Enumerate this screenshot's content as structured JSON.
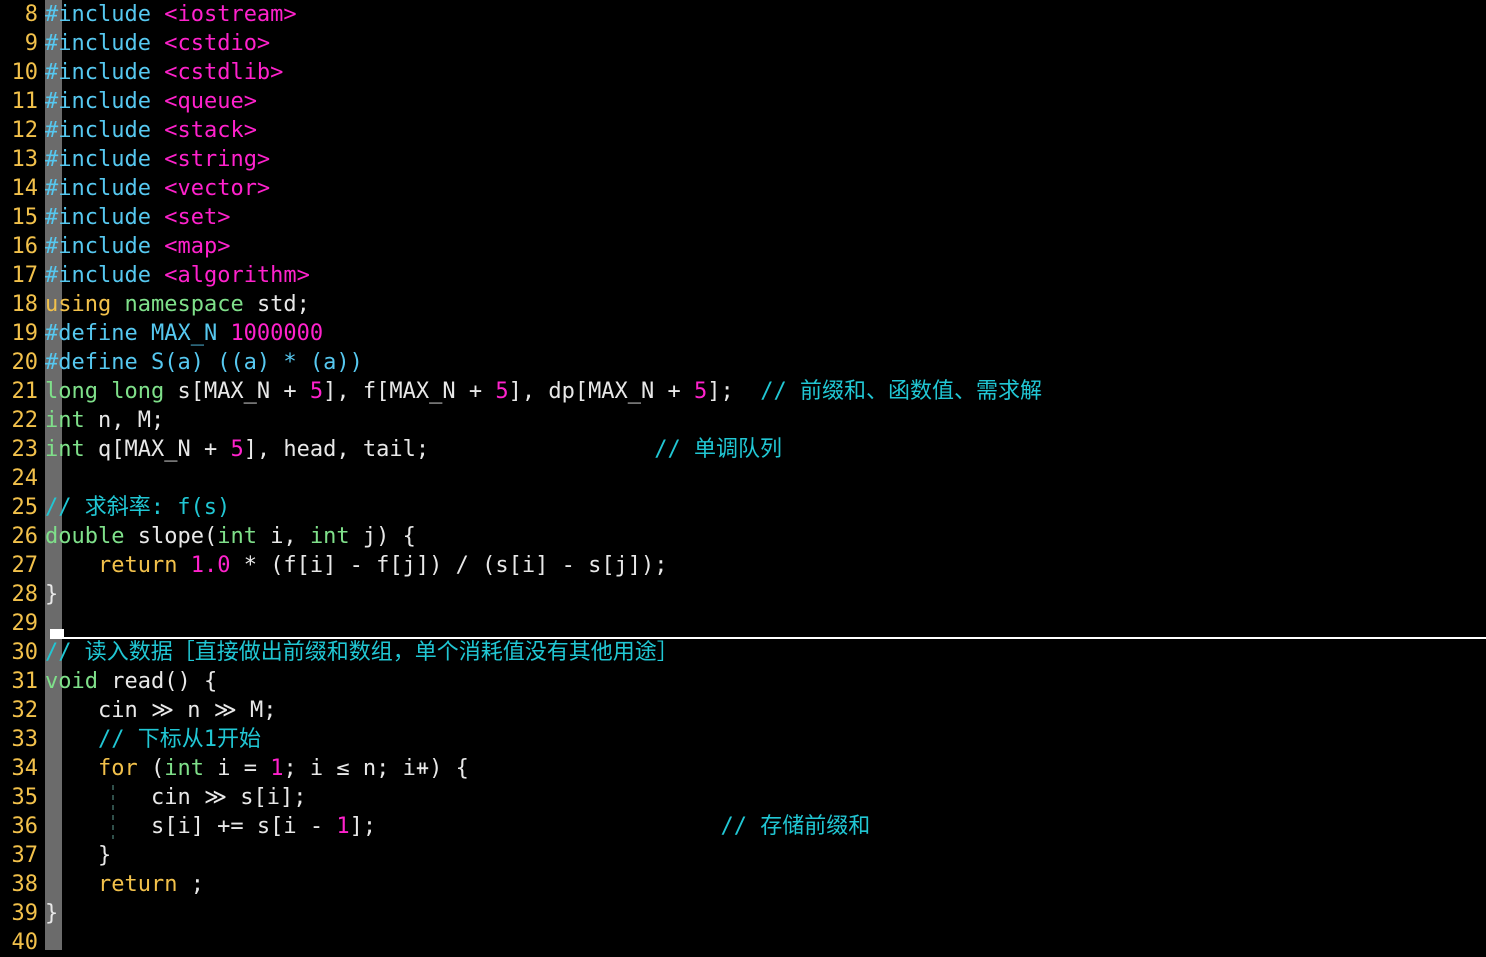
{
  "editor": {
    "language": "C++",
    "first_line": 8,
    "last_line": 40,
    "colors": {
      "background": "#000000",
      "line_number": "#f2c14b",
      "preprocessor": "#56c8f0",
      "header_name": "#ff22cc",
      "keyword": "#f2c14b",
      "type": "#7fe08a",
      "number": "#ff22cc",
      "comment": "#21c7d4",
      "plain_text": "#e8e8e8",
      "scope_bar": "#6b6b6b",
      "fold_separator": "#ffffff",
      "indent_guide": "#2f4f4a"
    }
  },
  "lines": [
    {
      "n": "8",
      "tokens": [
        {
          "t": "pre",
          "v": "#include "
        },
        {
          "t": "hdr",
          "v": "<iostream>"
        }
      ]
    },
    {
      "n": "9",
      "tokens": [
        {
          "t": "pre",
          "v": "#include "
        },
        {
          "t": "hdr",
          "v": "<cstdio>"
        }
      ]
    },
    {
      "n": "10",
      "tokens": [
        {
          "t": "pre",
          "v": "#include "
        },
        {
          "t": "hdr",
          "v": "<cstdlib>"
        }
      ]
    },
    {
      "n": "11",
      "tokens": [
        {
          "t": "pre",
          "v": "#include "
        },
        {
          "t": "hdr",
          "v": "<queue>"
        }
      ]
    },
    {
      "n": "12",
      "tokens": [
        {
          "t": "pre",
          "v": "#include "
        },
        {
          "t": "hdr",
          "v": "<stack>"
        }
      ]
    },
    {
      "n": "13",
      "tokens": [
        {
          "t": "pre",
          "v": "#include "
        },
        {
          "t": "hdr",
          "v": "<string>"
        }
      ]
    },
    {
      "n": "14",
      "tokens": [
        {
          "t": "pre",
          "v": "#include "
        },
        {
          "t": "hdr",
          "v": "<vector>"
        }
      ]
    },
    {
      "n": "15",
      "tokens": [
        {
          "t": "pre",
          "v": "#include "
        },
        {
          "t": "hdr",
          "v": "<set>"
        }
      ]
    },
    {
      "n": "16",
      "tokens": [
        {
          "t": "pre",
          "v": "#include "
        },
        {
          "t": "hdr",
          "v": "<map>"
        }
      ]
    },
    {
      "n": "17",
      "tokens": [
        {
          "t": "pre",
          "v": "#include "
        },
        {
          "t": "hdr",
          "v": "<algorithm>"
        }
      ]
    },
    {
      "n": "18",
      "tokens": [
        {
          "t": "kw",
          "v": "using "
        },
        {
          "t": "type",
          "v": "namespace "
        },
        {
          "t": "txt",
          "v": "std;"
        }
      ]
    },
    {
      "n": "19",
      "tokens": [
        {
          "t": "pre",
          "v": "#define MAX_N "
        },
        {
          "t": "num",
          "v": "1000000"
        }
      ]
    },
    {
      "n": "20",
      "tokens": [
        {
          "t": "pre",
          "v": "#define S(a) ((a) * (a))"
        }
      ]
    },
    {
      "n": "21",
      "tokens": [
        {
          "t": "type",
          "v": "long long "
        },
        {
          "t": "txt",
          "v": "s[MAX_N + "
        },
        {
          "t": "num",
          "v": "5"
        },
        {
          "t": "txt",
          "v": "], f[MAX_N + "
        },
        {
          "t": "num",
          "v": "5"
        },
        {
          "t": "txt",
          "v": "], dp[MAX_N + "
        },
        {
          "t": "num",
          "v": "5"
        },
        {
          "t": "txt",
          "v": "];  "
        },
        {
          "t": "cmt",
          "v": "// 前缀和、函数值、需求解"
        }
      ]
    },
    {
      "n": "22",
      "tokens": [
        {
          "t": "type",
          "v": "int "
        },
        {
          "t": "txt",
          "v": "n, M;"
        }
      ]
    },
    {
      "n": "23",
      "tokens": [
        {
          "t": "type",
          "v": "int "
        },
        {
          "t": "txt",
          "v": "q[MAX_N + "
        },
        {
          "t": "num",
          "v": "5"
        },
        {
          "t": "txt",
          "v": "], head, tail;                 "
        },
        {
          "t": "cmt",
          "v": "// 单调队列"
        }
      ]
    },
    {
      "n": "24",
      "tokens": []
    },
    {
      "n": "25",
      "tokens": [
        {
          "t": "cmt",
          "v": "// 求斜率: f(s)"
        }
      ]
    },
    {
      "n": "26",
      "tokens": [
        {
          "t": "type",
          "v": "double "
        },
        {
          "t": "txt",
          "v": "slope("
        },
        {
          "t": "type",
          "v": "int "
        },
        {
          "t": "txt",
          "v": "i, "
        },
        {
          "t": "type",
          "v": "int "
        },
        {
          "t": "txt",
          "v": "j) {"
        }
      ]
    },
    {
      "n": "27",
      "tokens": [
        {
          "t": "txt",
          "v": "    "
        },
        {
          "t": "kw",
          "v": "return "
        },
        {
          "t": "num",
          "v": "1.0"
        },
        {
          "t": "txt",
          "v": " * (f[i] - f[j]) / (s[i] - s[j]);"
        }
      ]
    },
    {
      "n": "28",
      "tokens": [
        {
          "t": "txt",
          "v": "}"
        }
      ]
    },
    {
      "n": "29",
      "tokens": []
    },
    {
      "n": "30",
      "tokens": [
        {
          "t": "cmt",
          "v": "// 读入数据［直接做出前缀和数组，单个消耗值没有其他用途］"
        }
      ]
    },
    {
      "n": "31",
      "tokens": [
        {
          "t": "type",
          "v": "void "
        },
        {
          "t": "txt",
          "v": "read() {"
        }
      ]
    },
    {
      "n": "32",
      "tokens": [
        {
          "t": "txt",
          "v": "    cin ≫ n ≫ M;"
        }
      ]
    },
    {
      "n": "33",
      "tokens": [
        {
          "t": "txt",
          "v": "    "
        },
        {
          "t": "cmt",
          "v": "// 下标从1开始"
        }
      ]
    },
    {
      "n": "34",
      "tokens": [
        {
          "t": "txt",
          "v": "    "
        },
        {
          "t": "kw",
          "v": "for "
        },
        {
          "t": "txt",
          "v": "("
        },
        {
          "t": "type",
          "v": "int "
        },
        {
          "t": "txt",
          "v": "i = "
        },
        {
          "t": "num",
          "v": "1"
        },
        {
          "t": "txt",
          "v": "; i ≤ n; i⧺) {"
        }
      ]
    },
    {
      "n": "35",
      "tokens": [
        {
          "t": "txt",
          "v": "        cin ≫ s[i];"
        }
      ]
    },
    {
      "n": "36",
      "tokens": [
        {
          "t": "txt",
          "v": "        s[i] += s[i - "
        },
        {
          "t": "num",
          "v": "1"
        },
        {
          "t": "txt",
          "v": "];                          "
        },
        {
          "t": "cmt",
          "v": "// 存储前缀和"
        }
      ]
    },
    {
      "n": "37",
      "tokens": [
        {
          "t": "txt",
          "v": "    }"
        }
      ]
    },
    {
      "n": "38",
      "tokens": [
        {
          "t": "txt",
          "v": "    "
        },
        {
          "t": "kw",
          "v": "return "
        },
        {
          "t": "txt",
          "v": ";"
        }
      ]
    },
    {
      "n": "39",
      "tokens": [
        {
          "t": "txt",
          "v": "}"
        }
      ]
    },
    {
      "n": "40",
      "tokens": []
    }
  ],
  "decorations": {
    "fold_separator": {
      "after_line": "29",
      "label": "section-fold-marker"
    },
    "indent_guides": [
      {
        "from_line": "35",
        "to_line": "36"
      }
    ]
  }
}
